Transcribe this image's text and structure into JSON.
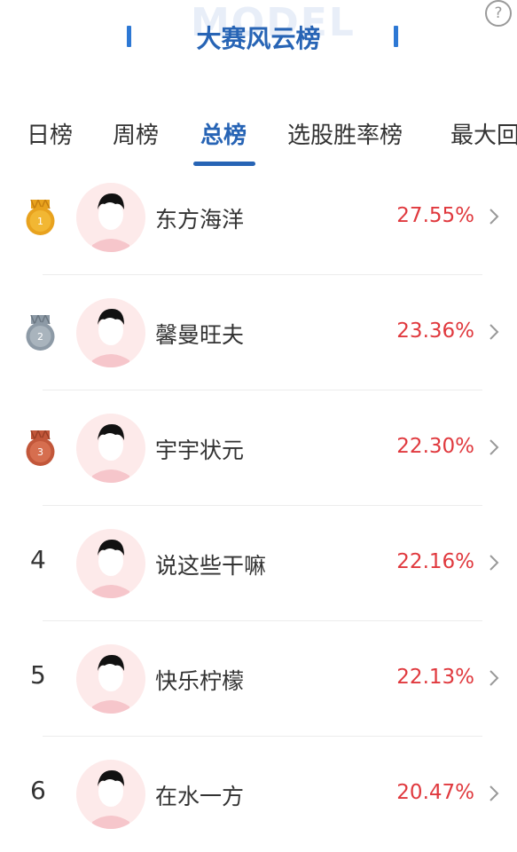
{
  "header": {
    "watermark": "MODEL",
    "title": "大赛风云榜",
    "help_label": "?"
  },
  "tabs": [
    {
      "label": "日榜",
      "active": false
    },
    {
      "label": "周榜",
      "active": false
    },
    {
      "label": "总榜",
      "active": true
    },
    {
      "label": "选股胜率榜",
      "active": false
    },
    {
      "label": "最大回",
      "active": false
    }
  ],
  "ranking": [
    {
      "rank": "1",
      "name": "东方海洋",
      "value": "27.55%"
    },
    {
      "rank": "2",
      "name": "馨曼旺夫",
      "value": "23.36%"
    },
    {
      "rank": "3",
      "name": "宇宇状元",
      "value": "22.30%"
    },
    {
      "rank": "4",
      "name": "说这些干嘛",
      "value": "22.16%"
    },
    {
      "rank": "5",
      "name": "快乐柠檬",
      "value": "22.13%"
    },
    {
      "rank": "6",
      "name": "在水一方",
      "value": "20.47%"
    }
  ],
  "colors": {
    "accent": "#2764b5",
    "positive": "#e0393e",
    "gold": "#e8a21e",
    "silver": "#8d9aa6",
    "bronze": "#c2573a"
  }
}
